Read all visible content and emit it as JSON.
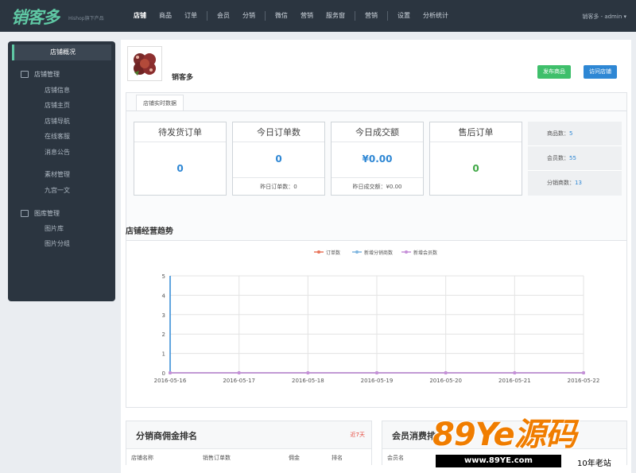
{
  "app": {
    "logo_text": "销客多",
    "logo_sub": "Hishop旗下产品",
    "user": "销客多 - admin ▾"
  },
  "nav": {
    "items": [
      "店铺",
      "商品",
      "订单",
      "会员",
      "分销",
      "微信",
      "营销",
      "服务窗",
      "营销",
      "设置",
      "分析统计"
    ]
  },
  "sidebar": {
    "header": "店铺概况",
    "group1": "店铺管理",
    "links1": [
      "店铺信息",
      "店铺主页",
      "店铺导航",
      "在线客服",
      "消息公告"
    ],
    "links2": [
      "素材管理",
      "九宫一文"
    ],
    "group2": "图库管理",
    "links3": [
      "图片库",
      "图片分组"
    ]
  },
  "shop": {
    "name": "销客多",
    "publish_button": "发布商品",
    "visit_button": "访问店铺"
  },
  "realtime": {
    "tab": "店铺实时数据",
    "cards": [
      {
        "title": "待发货订单",
        "value": "0",
        "sub": ""
      },
      {
        "title": "今日订单数",
        "value": "0",
        "sub": "昨日订单数：0"
      },
      {
        "title": "今日成交额",
        "value": "¥0.00",
        "sub": "昨日成交额：¥0.00"
      },
      {
        "title": "售后订单",
        "value": "0",
        "sub": ""
      }
    ],
    "stats": {
      "products_label": "商品数：",
      "products": "5",
      "members_label": "会员数：",
      "members": "55",
      "distributors_label": "分销商数：",
      "distributors": "13"
    }
  },
  "trend": {
    "title": "店铺经营趋势"
  },
  "chart_data": {
    "type": "line",
    "x": [
      "2016-05-16",
      "2016-05-17",
      "2016-05-18",
      "2016-05-19",
      "2016-05-20",
      "2016-05-21",
      "2016-05-22"
    ],
    "series": [
      {
        "name": "订单数",
        "values": [
          0,
          0,
          0,
          0,
          0,
          0,
          0
        ],
        "color": "#e8745a"
      },
      {
        "name": "新增分销商数",
        "values": [
          0,
          0,
          0,
          0,
          0,
          0,
          0
        ],
        "color": "#7fb6e0"
      },
      {
        "name": "新增会员数",
        "values": [
          0,
          0,
          0,
          0,
          0,
          0,
          0
        ],
        "color": "#c68fd8"
      }
    ],
    "yticks": [
      "0",
      "1",
      "2",
      "3",
      "4",
      "5"
    ],
    "ylim": [
      0,
      5
    ],
    "grid": true,
    "legend": "top-center"
  },
  "ranking": {
    "title": "分销商佣金排名",
    "tag": "近7天",
    "columns": [
      "店铺名称",
      "销售订单数",
      "佣金",
      "排名"
    ]
  },
  "member_rank": {
    "title": "会员消费排",
    "columns": [
      "会员名"
    ]
  },
  "watermark": {
    "main": "89Ye源码",
    "url": "www.89YE.com",
    "tag": "10年老站"
  }
}
